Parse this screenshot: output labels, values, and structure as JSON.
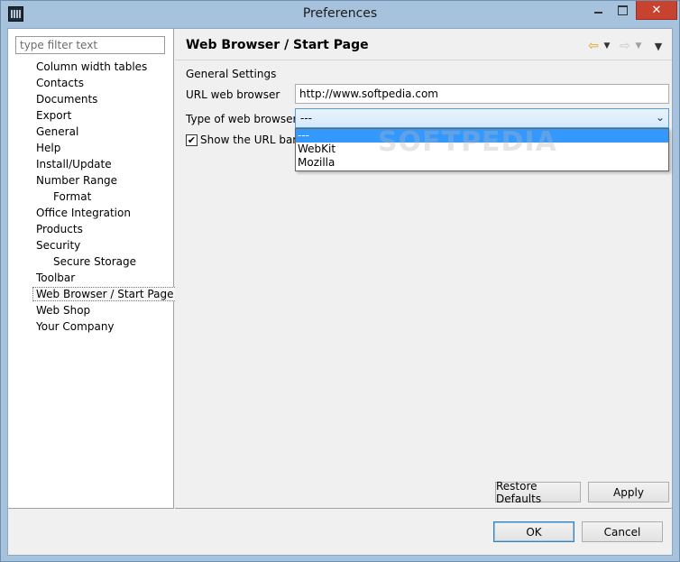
{
  "window": {
    "title": "Preferences",
    "close_label": "✕"
  },
  "filter": {
    "placeholder": "type filter text"
  },
  "tree": {
    "items": [
      {
        "label": "Column width tables",
        "level": 0
      },
      {
        "label": "Contacts",
        "level": 0
      },
      {
        "label": "Documents",
        "level": 0
      },
      {
        "label": "Export",
        "level": 0
      },
      {
        "label": "General",
        "level": 0
      },
      {
        "label": "Help",
        "level": 0
      },
      {
        "label": "Install/Update",
        "level": 0
      },
      {
        "label": "Number Range",
        "level": 0
      },
      {
        "label": "Format",
        "level": 1
      },
      {
        "label": "Office Integration",
        "level": 0
      },
      {
        "label": "Products",
        "level": 0
      },
      {
        "label": "Security",
        "level": 0
      },
      {
        "label": "Secure Storage",
        "level": 1
      },
      {
        "label": "Toolbar",
        "level": 0
      },
      {
        "label": "Web Browser / Start Page",
        "level": 0,
        "selected": true
      },
      {
        "label": "Web Shop",
        "level": 0
      },
      {
        "label": "Your Company",
        "level": 0
      }
    ]
  },
  "page": {
    "title": "Web Browser / Start Page",
    "section": "General Settings",
    "url_label": "URL web browser",
    "url_value": "http://www.softpedia.com",
    "type_label": "Type of web browser:",
    "type_value": "---",
    "type_options": [
      "---",
      "WebKit",
      "Mozilla"
    ],
    "show_url_label": "Show the URL bar",
    "show_url_checked": true,
    "restore_label": "Restore Defaults",
    "apply_label": "Apply"
  },
  "dialog": {
    "ok_label": "OK",
    "cancel_label": "Cancel"
  },
  "watermark": "SOFTPEDIA",
  "colors": {
    "selection": "#3399ff",
    "close": "#c7432f",
    "back_arrow": "#e2a21d"
  }
}
